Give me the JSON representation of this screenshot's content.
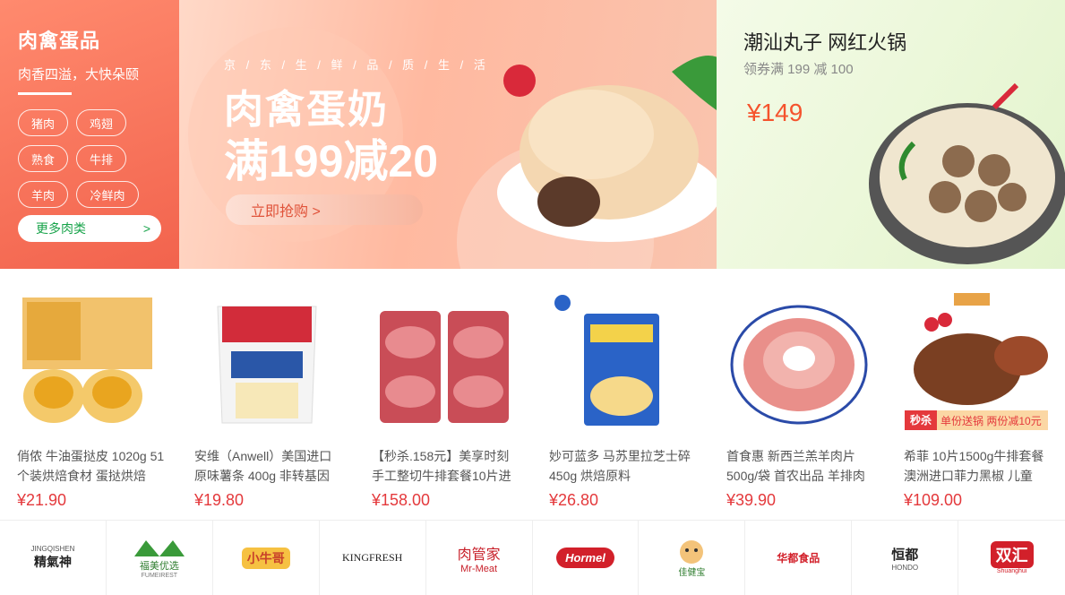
{
  "category": {
    "title": "肉禽蛋品",
    "subtitle": "肉香四溢，大快朵颐",
    "chips": [
      "猪肉",
      "鸡翅",
      "熟食",
      "牛排",
      "羊肉",
      "冷鲜肉"
    ],
    "more_label": "更多肉类",
    "more_arrow": ">"
  },
  "banner": {
    "tagline": "京 / 东 / 生 / 鲜 / 品 / 质 / 生 / 活",
    "headline": "肉禽蛋奶",
    "offer": "满199减20",
    "cta": "立即抢购 >"
  },
  "promo": {
    "title": "潮汕丸子 网红火锅",
    "coupon": "领券满 199 减 100",
    "price": "¥149"
  },
  "products": [
    {
      "name": "俏侬 牛油蛋挞皮 1020g 51个装烘焙食材 蛋挞烘焙",
      "price": "¥21.90"
    },
    {
      "name": "安维（Anwell）美国进口原味薯条 400g 非转基因",
      "price": "¥19.80"
    },
    {
      "name": "【秒杀.158元】美享时刻 手工整切牛排套餐10片进",
      "price": "¥158.00"
    },
    {
      "name": "妙可蓝多 马苏里拉芝士碎450g 烘焙原料",
      "price": "¥26.80"
    },
    {
      "name": "首食惠 新西兰羔羊肉片500g/袋 首农出品 羊排肉",
      "price": "¥39.90"
    },
    {
      "name": "希菲 10片1500g牛排套餐 澳洲进口菲力黑椒 儿童",
      "price": "¥109.00",
      "badge": "秒杀",
      "badge_text": "单份送锅 两份减10元"
    }
  ],
  "brands": [
    {
      "name": "精氣神",
      "sub": "JINGQISHEN"
    },
    {
      "name": "福美优选",
      "sub": "FUMEIREST"
    },
    {
      "name": "小牛哥",
      "sub": ""
    },
    {
      "name": "KINGFRESH",
      "sub": ""
    },
    {
      "name": "肉管家",
      "sub": "Mr-Meat"
    },
    {
      "name": "Hormel",
      "sub": ""
    },
    {
      "name": "佳健宝",
      "sub": ""
    },
    {
      "name": "华都食品",
      "sub": ""
    },
    {
      "name": "恒都",
      "sub": "HONDO"
    },
    {
      "name": "双汇",
      "sub": "Shuanghui"
    }
  ]
}
